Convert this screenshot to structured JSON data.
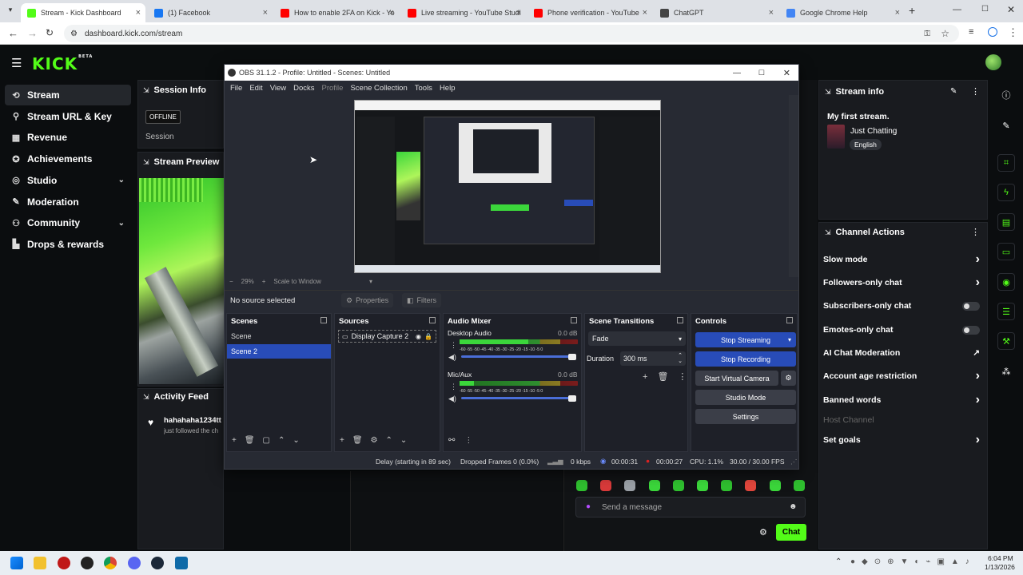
{
  "browser": {
    "tabs": [
      {
        "label": "Stream - Kick Dashboard",
        "color": "#53fc18"
      },
      {
        "label": "(1) Facebook",
        "color": "#1877f2"
      },
      {
        "label": "How to enable 2FA on Kick - Yo",
        "color": "#ff0000"
      },
      {
        "label": "Live streaming - YouTube Studi",
        "color": "#ff0000"
      },
      {
        "label": "Phone verification - YouTube",
        "color": "#ff0000"
      },
      {
        "label": "ChatGPT",
        "color": "#444444"
      },
      {
        "label": "Google Chrome Help",
        "color": "#4285f4"
      }
    ],
    "url": "dashboard.kick.com/stream"
  },
  "kick": {
    "logo": "KICK",
    "logo_badge": "BETA",
    "nav": [
      {
        "label": "Stream",
        "icon": "stream-icon",
        "active": true
      },
      {
        "label": "Stream URL & Key",
        "icon": "link-icon"
      },
      {
        "label": "Revenue",
        "icon": "revenue-icon"
      },
      {
        "label": "Achievements",
        "icon": "trophy-icon"
      },
      {
        "label": "Studio",
        "icon": "studio-icon",
        "expand": true
      },
      {
        "label": "Moderation",
        "icon": "wrench-icon"
      },
      {
        "label": "Community",
        "icon": "people-icon",
        "expand": true
      },
      {
        "label": "Drops & rewards",
        "icon": "drops-icon"
      }
    ],
    "session": {
      "title": "Session Info",
      "status": "OFFLINE",
      "label": "Session"
    },
    "preview": {
      "title": "Stream Preview"
    },
    "activity": {
      "title": "Activity Feed",
      "user": "hahahaha1234tt",
      "event": "just followed the ch"
    },
    "stream_info": {
      "title": "Stream info",
      "stream_title": "My first stream.",
      "category": "Just Chatting",
      "language": "English"
    },
    "channel_actions": {
      "title": "Channel Actions",
      "items": [
        {
          "label": "Slow mode",
          "control": "chevron"
        },
        {
          "label": "Followers-only chat",
          "control": "chevron"
        },
        {
          "label": "Subscribers-only chat",
          "control": "toggle"
        },
        {
          "label": "Emotes-only chat",
          "control": "toggle"
        },
        {
          "label": "AI Chat Moderation",
          "control": "external"
        },
        {
          "label": "Account age restriction",
          "control": "chevron"
        },
        {
          "label": "Banned words",
          "control": "chevron"
        },
        {
          "label": "Host Channel",
          "control": "none",
          "disabled": true
        },
        {
          "label": "Set goals",
          "control": "chevron"
        }
      ]
    },
    "chat": {
      "placeholder": "Send a message",
      "button": "Chat"
    }
  },
  "obs": {
    "title": "OBS 31.1.2 - Profile: Untitled - Scenes: Untitled",
    "menu": [
      "File",
      "Edit",
      "View",
      "Docks",
      "Profile",
      "Scene Collection",
      "Tools",
      "Help"
    ],
    "zoom": "29%",
    "scale_mode": "Scale to Window",
    "no_source": "No source selected",
    "properties": "Properties",
    "filters": "Filters",
    "scenes": {
      "title": "Scenes",
      "items": [
        "Scene",
        "Scene 2"
      ],
      "selected": 1
    },
    "sources": {
      "title": "Sources",
      "items": [
        "Display Capture 2"
      ]
    },
    "mixer": {
      "title": "Audio Mixer",
      "channels": [
        {
          "name": "Desktop Audio",
          "db": "0.0 dB",
          "level": 0.58
        },
        {
          "name": "Mic/Aux",
          "db": "0.0 dB",
          "level": 0.12
        }
      ],
      "scale": "-60 -55 -50 -45 -40 -35 -30 -25 -20 -15 -10 -5 0"
    },
    "transitions": {
      "title": "Scene Transitions",
      "type": "Fade",
      "duration_label": "Duration",
      "duration": "300 ms"
    },
    "controls": {
      "title": "Controls",
      "stop_streaming": "Stop Streaming",
      "stop_recording": "Stop Recording",
      "virtual_camera": "Start Virtual Camera",
      "studio_mode": "Studio Mode",
      "settings": "Settings"
    },
    "status": {
      "delay": "Delay (starting in 89 sec)",
      "dropped": "Dropped Frames 0 (0.0%)",
      "kbps": "0 kbps",
      "stream_time": "00:00:31",
      "rec_time": "00:00:27",
      "cpu": "CPU: 1.1%",
      "fps": "30.00 / 30.00 FPS"
    }
  },
  "system": {
    "time": "6:04 PM",
    "date": "1/13/2026"
  }
}
